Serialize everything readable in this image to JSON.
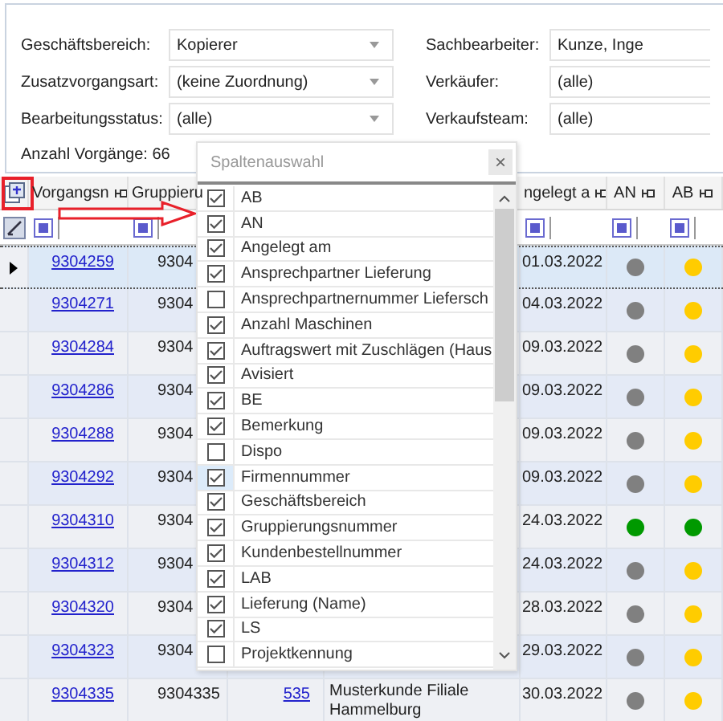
{
  "filters_left": [
    {
      "label": "Geschäftsbereich:",
      "value": "Kopierer"
    },
    {
      "label": "Zusatzvorgangsart:",
      "value": "(keine Zuordnung)"
    },
    {
      "label": "Bearbeitungsstatus:",
      "value": "(alle)"
    }
  ],
  "filters_right": [
    {
      "label": "Sachbearbeiter:",
      "value": "Kunze, Inge"
    },
    {
      "label": "Verkäufer:",
      "value": "(alle)"
    },
    {
      "label": "Verkaufsteam:",
      "value": "(alle)"
    }
  ],
  "count_label": "Anzahl Vorgänge: 66",
  "table": {
    "columns": [
      {
        "label": "Vorgangsn"
      },
      {
        "label": "Gruppieru"
      },
      {
        "label": "ngelegt a"
      },
      {
        "label": "AN"
      },
      {
        "label": "AB"
      }
    ],
    "rows": [
      {
        "vorgang": "9304259",
        "gruppierung": "9304",
        "date": "01.03.2022",
        "selected": true,
        "an": {
          "color": "#808080"
        },
        "ab": {
          "color": "#ffcc00"
        }
      },
      {
        "vorgang": "9304271",
        "gruppierung": "9304",
        "date": "04.03.2022",
        "selected": false,
        "an": {
          "color": "#808080"
        },
        "ab": {
          "color": "#ffcc00"
        }
      },
      {
        "vorgang": "9304284",
        "gruppierung": "9304",
        "date": "09.03.2022",
        "selected": false,
        "an": {
          "color": "#808080"
        },
        "ab": {
          "color": "#ffcc00"
        }
      },
      {
        "vorgang": "9304286",
        "gruppierung": "9304",
        "date": "09.03.2022",
        "selected": false,
        "an": {
          "color": "#808080"
        },
        "ab": {
          "color": "#ffcc00"
        }
      },
      {
        "vorgang": "9304288",
        "gruppierung": "9304",
        "date": "09.03.2022",
        "selected": false,
        "an": {
          "color": "#808080"
        },
        "ab": {
          "color": "#ffcc00"
        }
      },
      {
        "vorgang": "9304292",
        "gruppierung": "9304",
        "date": "09.03.2022",
        "selected": false,
        "an": {
          "color": "#808080"
        },
        "ab": {
          "color": "#ffcc00"
        }
      },
      {
        "vorgang": "9304310",
        "gruppierung": "9304",
        "date": "24.03.2022",
        "selected": false,
        "an": {
          "color": "#009900"
        },
        "ab": {
          "color": "#009900"
        }
      },
      {
        "vorgang": "9304312",
        "gruppierung": "9304",
        "date": "24.03.2022",
        "selected": false,
        "an": {
          "color": "#808080"
        },
        "ab": {
          "color": "#ffcc00"
        }
      },
      {
        "vorgang": "9304320",
        "gruppierung": "9304",
        "date": "28.03.2022",
        "selected": false,
        "an": {
          "color": "#808080"
        },
        "ab": {
          "color": "#ffcc00"
        }
      },
      {
        "vorgang": "9304323",
        "gruppierung": "9304",
        "date": "29.03.2022",
        "selected": false,
        "an": {
          "color": "#808080"
        },
        "ab": {
          "color": "#ffcc00"
        }
      },
      {
        "vorgang": "9304335",
        "gruppierung": "9304335",
        "number": "535",
        "customer": "Musterkunde Filiale Hammelburg",
        "date": "30.03.2022",
        "selected": false,
        "an": {
          "color": "#808080"
        },
        "ab": {
          "color": "#ffcc00"
        }
      }
    ]
  },
  "column_chooser": {
    "title": "Spaltenauswahl",
    "close": "×",
    "items": [
      {
        "label": "AB",
        "checked": true,
        "selected": false
      },
      {
        "label": "AN",
        "checked": true,
        "selected": false
      },
      {
        "label": "Angelegt am",
        "checked": true,
        "selected": false
      },
      {
        "label": "Ansprechpartner Lieferung",
        "checked": true,
        "selected": false
      },
      {
        "label": "Ansprechpartnernummer Liefersch",
        "checked": false,
        "selected": false
      },
      {
        "label": "Anzahl Maschinen",
        "checked": true,
        "selected": false
      },
      {
        "label": "Auftragswert mit Zuschlägen (Haus",
        "checked": true,
        "selected": false
      },
      {
        "label": "Avisiert",
        "checked": true,
        "selected": false
      },
      {
        "label": "BE",
        "checked": true,
        "selected": false
      },
      {
        "label": "Bemerkung",
        "checked": true,
        "selected": false
      },
      {
        "label": "Dispo",
        "checked": false,
        "selected": false
      },
      {
        "label": "Firmennummer",
        "checked": true,
        "selected": true
      },
      {
        "label": "Geschäftsbereich",
        "checked": true,
        "selected": false
      },
      {
        "label": "Gruppierungsnummer",
        "checked": true,
        "selected": false
      },
      {
        "label": "Kundenbestellnummer",
        "checked": true,
        "selected": false
      },
      {
        "label": "LAB",
        "checked": true,
        "selected": false
      },
      {
        "label": "Lieferung (Name)",
        "checked": true,
        "selected": false
      },
      {
        "label": "LS",
        "checked": true,
        "selected": false
      },
      {
        "label": "Projektkennung",
        "checked": false,
        "selected": false
      }
    ]
  }
}
